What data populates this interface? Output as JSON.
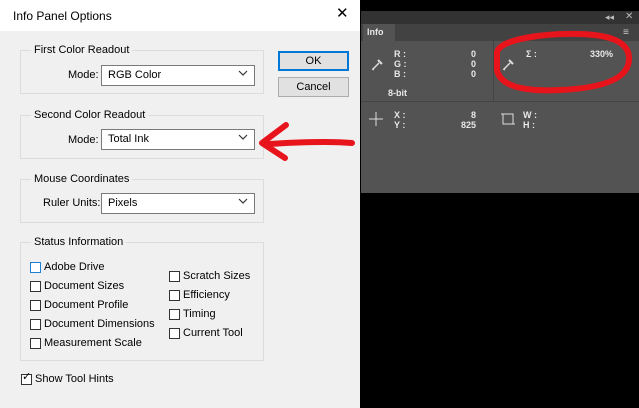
{
  "dialog": {
    "title": "Info Panel Options",
    "close_icon": "close-icon",
    "first_readout": {
      "legend": "First Color Readout",
      "mode_label": "Mode:",
      "mode_value": "RGB Color"
    },
    "second_readout": {
      "legend": "Second Color Readout",
      "mode_label": "Mode:",
      "mode_value": "Total Ink"
    },
    "mouse": {
      "legend": "Mouse Coordinates",
      "units_label": "Ruler Units:",
      "units_value": "Pixels"
    },
    "status": {
      "legend": "Status Information",
      "left": [
        "Adobe Drive",
        "Document Sizes",
        "Document Profile",
        "Document Dimensions",
        "Measurement Scale"
      ],
      "right": [
        "Scratch Sizes",
        "Efficiency",
        "Timing",
        "Current Tool"
      ]
    },
    "show_tool_hints": {
      "label": "Show Tool Hints",
      "checked": true
    },
    "ok_label": "OK",
    "cancel_label": "Cancel"
  },
  "panel": {
    "tab": "Info",
    "r": "R :",
    "g": "G :",
    "b": "B :",
    "r_val": "0",
    "g_val": "0",
    "b_val": "0",
    "sigma": "Σ :",
    "sigma_val": "330%",
    "bits": "8-bit",
    "x": "X :",
    "y": "Y :",
    "x_val": "8",
    "y_val": "825",
    "w": "W :",
    "h": "H :"
  },
  "annotations": {
    "arrow_color": "#e8141b",
    "ring_color": "#e8141b"
  }
}
